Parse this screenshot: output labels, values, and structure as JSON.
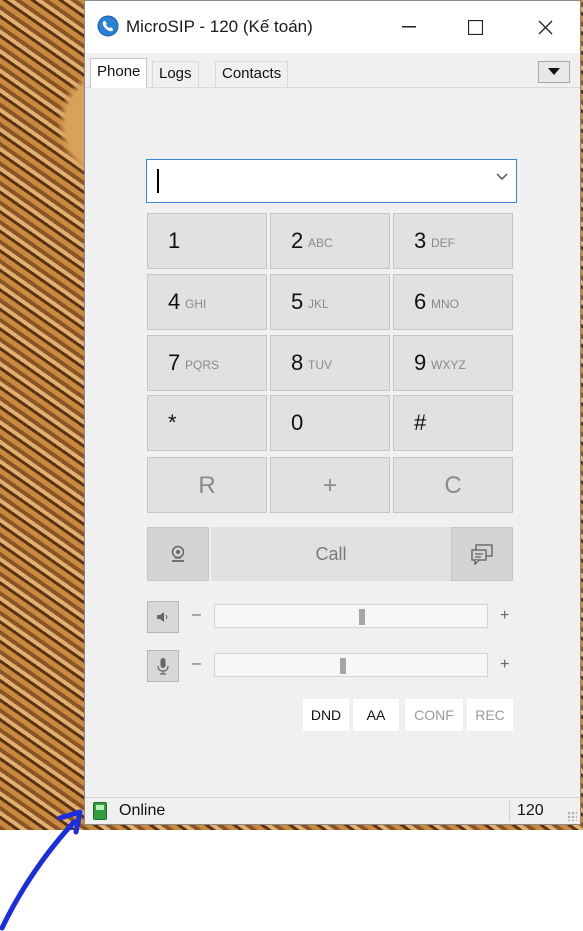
{
  "window": {
    "title": "MicroSIP - 120 (Kế toán)"
  },
  "tabs": [
    {
      "label": "Phone",
      "active": true
    },
    {
      "label": "Logs",
      "active": false
    },
    {
      "label": "Contacts",
      "active": false
    }
  ],
  "dialpad": {
    "number_value": "",
    "keys": [
      {
        "digit": "1",
        "letters": ""
      },
      {
        "digit": "2",
        "letters": "ABC"
      },
      {
        "digit": "3",
        "letters": "DEF"
      },
      {
        "digit": "4",
        "letters": "GHI"
      },
      {
        "digit": "5",
        "letters": "JKL"
      },
      {
        "digit": "6",
        "letters": "MNO"
      },
      {
        "digit": "7",
        "letters": "PQRS"
      },
      {
        "digit": "8",
        "letters": "TUV"
      },
      {
        "digit": "9",
        "letters": "WXYZ"
      },
      {
        "digit": "*",
        "letters": ""
      },
      {
        "digit": "0",
        "letters": ""
      },
      {
        "digit": "#",
        "letters": ""
      },
      {
        "digit": "R",
        "letters": ""
      },
      {
        "digit": "+",
        "letters": ""
      },
      {
        "digit": "C",
        "letters": ""
      }
    ]
  },
  "actions": {
    "call_label": "Call"
  },
  "volume": {
    "speaker_minus": "–",
    "speaker_plus": "+",
    "speaker_level": 0.54,
    "mic_minus": "–",
    "mic_plus": "+",
    "mic_level": 0.47
  },
  "toggles": [
    {
      "label": "DND",
      "enabled": true
    },
    {
      "label": "AA",
      "enabled": true
    },
    {
      "label": "CONF",
      "enabled": false
    },
    {
      "label": "REC",
      "enabled": false
    }
  ],
  "status": {
    "text": "Online",
    "extension": "120"
  },
  "icons": {
    "app": "microsip-phone-icon",
    "video": "video-call-icon",
    "message": "message-icon",
    "speaker": "speaker-icon",
    "mic": "microphone-icon"
  },
  "colors": {
    "accent_border": "#3b86d8",
    "status_online": "#2f9e3d",
    "annotation_arrow": "#1a2ee0"
  }
}
